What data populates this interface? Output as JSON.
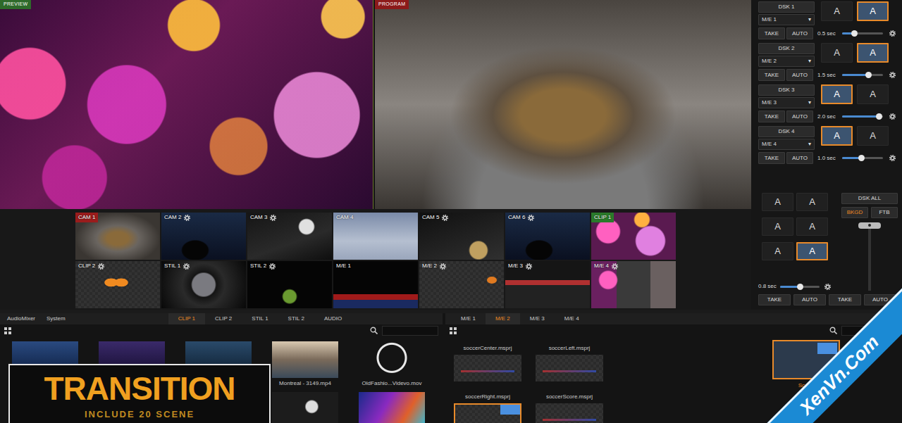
{
  "monitors": [
    {
      "label": "PREVIEW",
      "kind": "preview"
    },
    {
      "label": "PROGRAM",
      "kind": "program"
    }
  ],
  "dsk": [
    {
      "label": "DSK 1",
      "source": "M/E 1",
      "arrow": "▾",
      "buttons": [
        {
          "label": "A",
          "selected": false
        },
        {
          "label": "A",
          "selected": true
        }
      ],
      "take": "TAKE",
      "auto": "AUTO",
      "duration": "0.5 sec",
      "level": 0.3
    },
    {
      "label": "DSK 2",
      "source": "M/E 2",
      "arrow": "▾",
      "buttons": [
        {
          "label": "A",
          "selected": false
        },
        {
          "label": "A",
          "selected": true
        }
      ],
      "take": "TAKE",
      "auto": "AUTO",
      "duration": "1.5 sec",
      "level": 0.63
    },
    {
      "label": "DSK 3",
      "source": "M/E 3",
      "arrow": "▾",
      "buttons": [
        {
          "label": "A",
          "selected": true
        },
        {
          "label": "A",
          "selected": false
        }
      ],
      "take": "TAKE",
      "auto": "AUTO",
      "duration": "2.0 sec",
      "level": 0.9
    },
    {
      "label": "DSK 4",
      "source": "M/E 4",
      "arrow": "▾",
      "buttons": [
        {
          "label": "A",
          "selected": true
        },
        {
          "label": "A",
          "selected": false
        }
      ],
      "take": "TAKE",
      "auto": "AUTO",
      "duration": "1.0 sec",
      "level": 0.47
    }
  ],
  "transition": {
    "buttons": [
      {
        "label": "A",
        "selected": false
      },
      {
        "label": "A",
        "selected": false
      },
      {
        "label": "A",
        "selected": false
      },
      {
        "label": "A",
        "selected": false
      },
      {
        "label": "A",
        "selected": false
      },
      {
        "label": "A",
        "selected": true
      }
    ],
    "dsk_all": "DSK ALL",
    "bkgd": {
      "label": "BKGD",
      "selected": true
    },
    "ftb": {
      "label": "FTB",
      "selected": false
    },
    "tbar_level": 0,
    "duration": "0.8 sec",
    "level": 0.5,
    "actions": [
      "TAKE",
      "AUTO",
      "TAKE",
      "AUTO"
    ]
  },
  "sources": [
    {
      "label": "CAM 1",
      "settings": false,
      "on_program": true,
      "on_preview": false
    },
    {
      "label": "CAM 2",
      "settings": true,
      "on_program": false,
      "on_preview": false
    },
    {
      "label": "CAM 3",
      "settings": true,
      "on_program": false,
      "on_preview": false
    },
    {
      "label": "CAM 4",
      "settings": false,
      "on_program": false,
      "on_preview": false
    },
    {
      "label": "CAM 5",
      "settings": true,
      "on_program": false,
      "on_preview": false
    },
    {
      "label": "CAM 6",
      "settings": true,
      "on_program": false,
      "on_preview": false
    },
    {
      "label": "CLIP 1",
      "settings": false,
      "on_program": false,
      "on_preview": true
    },
    {
      "label": "CLIP 2",
      "settings": true,
      "on_program": false,
      "on_preview": false
    },
    {
      "label": "STIL 1",
      "settings": true,
      "on_program": false,
      "on_preview": false
    },
    {
      "label": "STIL 2",
      "settings": true,
      "on_program": false,
      "on_preview": false
    },
    {
      "label": "M/E 1",
      "settings": false,
      "on_program": false,
      "on_preview": false
    },
    {
      "label": "M/E 2",
      "settings": true,
      "on_program": false,
      "on_preview": false
    },
    {
      "label": "M/E 3",
      "settings": true,
      "on_program": false,
      "on_preview": false
    },
    {
      "label": "M/E 4",
      "settings": true,
      "on_program": false,
      "on_preview": false
    }
  ],
  "library": {
    "menu": [
      "AudioMixer",
      "System"
    ],
    "tabs": [
      {
        "label": "CLIP 1",
        "selected": true
      },
      {
        "label": "CLIP 2",
        "selected": false
      },
      {
        "label": "STIL 1",
        "selected": false
      },
      {
        "label": "STIL 2",
        "selected": false
      },
      {
        "label": "AUDIO",
        "selected": false
      }
    ],
    "files": [
      {
        "label": ""
      },
      {
        "label": ""
      },
      {
        "label": ""
      },
      {
        "label": "Montreal - 3149.mp4"
      },
      {
        "label": "OldFashio...Videvo.mov"
      },
      {
        "label": ""
      },
      {
        "label": ""
      },
      {
        "label": ""
      },
      {
        "label": ""
      },
      {
        "label": ""
      }
    ]
  },
  "me_library": {
    "tabs": [
      {
        "label": "M/E 1",
        "selected": false
      },
      {
        "label": "M/E 2",
        "selected": true
      },
      {
        "label": "M/E 3",
        "selected": false
      },
      {
        "label": "M/E 4",
        "selected": false
      }
    ],
    "files": [
      {
        "label": "soccerCenter.msprj",
        "selected": false
      },
      {
        "label": "soccerLeft.msprj",
        "selected": false
      },
      {
        "label": "soccerRight.msprj",
        "selected": true
      },
      {
        "label": "soccerScore.msprj",
        "selected": false
      }
    ],
    "scene": {
      "label": "Scene",
      "selected": true
    }
  },
  "overlay": {
    "title": "TRANSITION",
    "subtitle": "INCLUDE 20 SCENE"
  },
  "watermark": {
    "text": "XenVn.Com"
  }
}
